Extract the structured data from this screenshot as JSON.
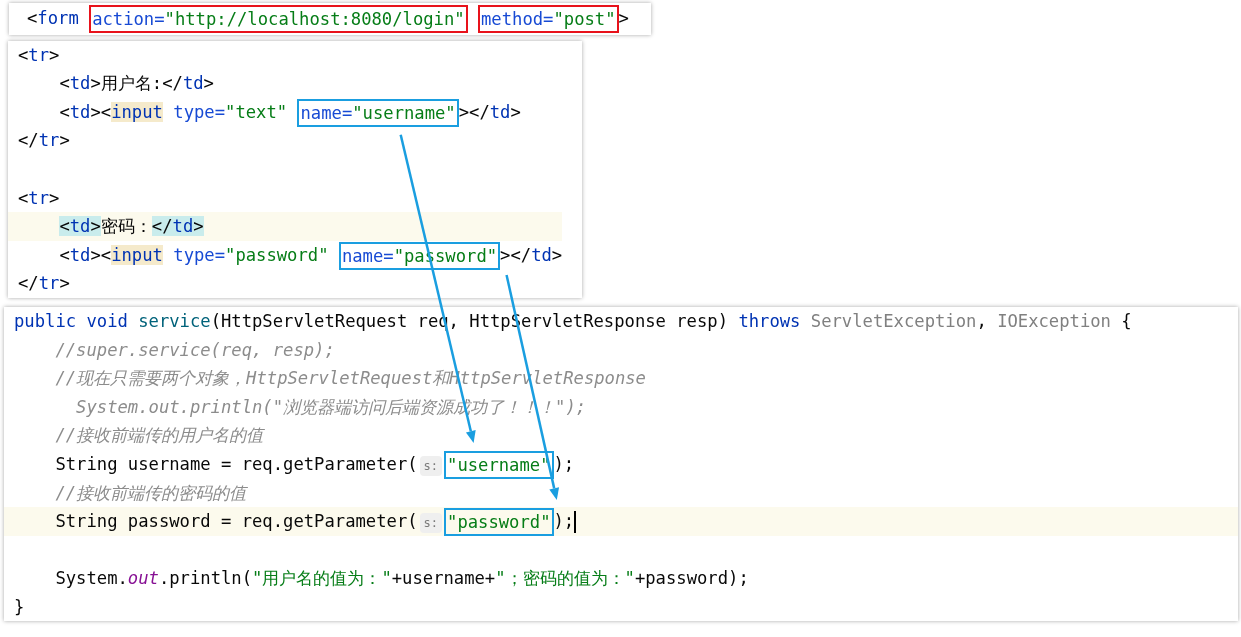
{
  "panels": [
    {
      "lines": [
        {
          "current": false,
          "caret": false,
          "tokens": [
            {
              "text": "<",
              "kind": "punct"
            },
            {
              "text": "form",
              "kind": "tag"
            },
            {
              "kind": "box",
              "color": "#e8121b",
              "tokens": [
                {
                  "text": " action=",
                  "kind": "attr"
                },
                {
                  "text": "\"http://localhost:8080/login\"",
                  "kind": "str"
                }
              ]
            },
            {
              "kind": "box",
              "color": "#e8121b",
              "tokens": [
                {
                  "text": " method=",
                  "kind": "attr"
                },
                {
                  "text": "\"post\"",
                  "kind": "str"
                }
              ]
            },
            {
              "text": ">",
              "kind": "punct"
            }
          ]
        }
      ]
    },
    {
      "lines": [
        {
          "current": false,
          "caret": false,
          "tokens": [
            {
              "text": "<",
              "kind": "punct"
            },
            {
              "text": "tr",
              "kind": "tag"
            },
            {
              "text": ">",
              "kind": "punct"
            }
          ]
        },
        {
          "current": false,
          "caret": false,
          "tokens": [
            {
              "text": "    <",
              "kind": "punct"
            },
            {
              "text": "td",
              "kind": "tag"
            },
            {
              "text": ">用户名:</",
              "kind": "punct"
            },
            {
              "text": "td",
              "kind": "tag"
            },
            {
              "text": ">",
              "kind": "punct"
            }
          ]
        },
        {
          "current": false,
          "caret": false,
          "tokens": [
            {
              "text": "    <",
              "kind": "punct"
            },
            {
              "text": "td",
              "kind": "tag"
            },
            {
              "text": "><",
              "kind": "punct"
            },
            {
              "text": "input",
              "kind": "tag_usage"
            },
            {
              "text": " type=",
              "kind": "attr"
            },
            {
              "text": "\"text\"",
              "kind": "str"
            },
            {
              "kind": "box",
              "color": "#1a9ee0",
              "tokens": [
                {
                  "text": " name=",
                  "kind": "attr"
                },
                {
                  "text": "\"username\"",
                  "kind": "str"
                }
              ]
            },
            {
              "text": "></",
              "kind": "punct"
            },
            {
              "text": "td",
              "kind": "tag"
            },
            {
              "text": ">",
              "kind": "punct"
            }
          ]
        },
        {
          "current": false,
          "caret": false,
          "tokens": [
            {
              "text": "</",
              "kind": "punct"
            },
            {
              "text": "tr",
              "kind": "tag"
            },
            {
              "text": ">",
              "kind": "punct"
            }
          ]
        },
        {
          "current": false,
          "caret": false
        },
        {
          "current": false,
          "caret": false,
          "tokens": [
            {
              "text": "<",
              "kind": "punct"
            },
            {
              "text": "tr",
              "kind": "tag"
            },
            {
              "text": ">",
              "kind": "punct"
            }
          ]
        },
        {
          "current": true,
          "caret": false,
          "tokens": [
            {
              "text": "    <",
              "kind": "matched_punct"
            },
            {
              "text": "td",
              "kind": "matched_tag"
            },
            {
              "text": ">",
              "kind": "matched_punct"
            },
            {
              "text": "密码：",
              "kind": "punct"
            },
            {
              "text": "</",
              "kind": "matched_punct"
            },
            {
              "text": "td",
              "kind": "matched_tag"
            },
            {
              "text": ">",
              "kind": "matched_punct"
            }
          ]
        },
        {
          "current": false,
          "caret": false,
          "tokens": [
            {
              "text": "    <",
              "kind": "punct"
            },
            {
              "text": "td",
              "kind": "tag"
            },
            {
              "text": "><",
              "kind": "punct"
            },
            {
              "text": "input",
              "kind": "tag_usage"
            },
            {
              "text": " type=",
              "kind": "attr"
            },
            {
              "text": "\"password\"",
              "kind": "str"
            },
            {
              "kind": "box",
              "color": "#1a9ee0",
              "tokens": [
                {
                  "text": " name=",
                  "kind": "attr"
                },
                {
                  "text": "\"password\"",
                  "kind": "str"
                }
              ]
            },
            {
              "text": "></",
              "kind": "punct"
            },
            {
              "text": "td",
              "kind": "tag"
            },
            {
              "text": ">",
              "kind": "punct"
            }
          ]
        },
        {
          "current": false,
          "caret": false,
          "tokens": [
            {
              "text": "</",
              "kind": "punct"
            },
            {
              "text": "tr",
              "kind": "tag"
            },
            {
              "text": ">",
              "kind": "punct"
            }
          ]
        }
      ]
    },
    {
      "lines": [
        {
          "current": false,
          "caret": false,
          "tokens": [
            {
              "text": "public void",
              "kind": "keyword"
            },
            {
              "text": " service",
              "kind": "method"
            },
            {
              "text": "(HttpServletRequest req, HttpServletResponse resp)",
              "kind": "punct"
            },
            {
              "text": " throws",
              "kind": "keyword"
            },
            {
              "text": " ServletException",
              "kind": "dim"
            },
            {
              "text": ",",
              "kind": "punct"
            },
            {
              "text": " IOException",
              "kind": "dim"
            },
            {
              "text": " {",
              "kind": "punct"
            }
          ]
        },
        {
          "current": false,
          "caret": false,
          "tokens": [
            {
              "text": "    //super.service(req, resp);",
              "kind": "comment"
            }
          ]
        },
        {
          "current": false,
          "caret": false,
          "tokens": [
            {
              "text": "    //现在只需要两个对象，HttpServletRequest和HttpServletResponse",
              "kind": "comment"
            }
          ]
        },
        {
          "current": false,
          "caret": false,
          "tokens": [
            {
              "text": "      System.out.println(\"浏览器端访问后端资源成功了！！！\");",
              "kind": "comment"
            }
          ]
        },
        {
          "current": false,
          "caret": false,
          "tokens": [
            {
              "text": "    //接收前端传的用户名的值",
              "kind": "comment"
            }
          ]
        },
        {
          "current": false,
          "caret": false,
          "tokens": [
            {
              "text": "    String username = req.getParameter(",
              "kind": "punct"
            },
            {
              "text": "s:",
              "kind": "hint"
            },
            {
              "kind": "box",
              "color": "#1a9ee0",
              "tokens": [
                {
                  "text": "\"username\"",
                  "kind": "str"
                }
              ]
            },
            {
              "text": ");",
              "kind": "punct"
            }
          ]
        },
        {
          "current": false,
          "caret": false,
          "tokens": [
            {
              "text": "    //接收前端传的密码的值",
              "kind": "comment"
            }
          ]
        },
        {
          "current": true,
          "caret": true,
          "tokens": [
            {
              "text": "    String password = req.getParameter(",
              "kind": "punct"
            },
            {
              "text": "s:",
              "kind": "hint"
            },
            {
              "kind": "box",
              "color": "#1a9ee0",
              "tokens": [
                {
                  "text": "\"password\"",
                  "kind": "str"
                }
              ]
            },
            {
              "text": ");",
              "kind": "punct"
            }
          ]
        },
        {
          "current": false,
          "caret": false
        },
        {
          "current": false,
          "caret": false,
          "tokens": [
            {
              "text": "    System.",
              "kind": "punct"
            },
            {
              "text": "out",
              "kind": "field"
            },
            {
              "text": ".println(",
              "kind": "punct"
            },
            {
              "text": "\"用户名的值为：\"",
              "kind": "str"
            },
            {
              "text": "+username+",
              "kind": "punct"
            },
            {
              "text": "\"；密码的值为：\"",
              "kind": "str"
            },
            {
              "text": "+password);",
              "kind": "punct"
            }
          ]
        },
        {
          "current": false,
          "caret": false,
          "tokens": [
            {
              "text": "}",
              "kind": "punct"
            }
          ]
        }
      ]
    }
  ]
}
